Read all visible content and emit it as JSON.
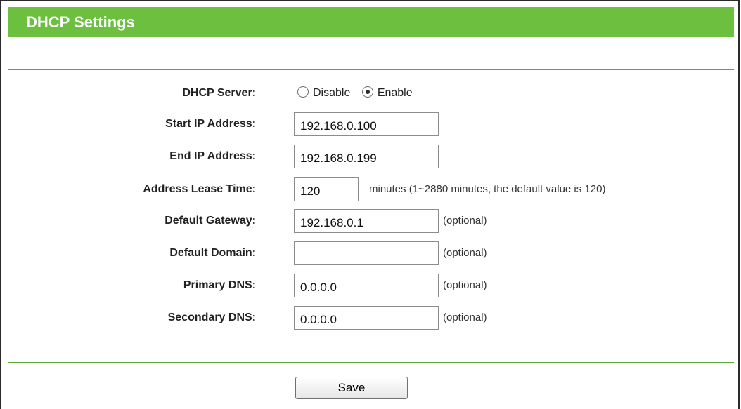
{
  "title": "DHCP Settings",
  "dhcp_server": {
    "label": "DHCP Server:",
    "options": [
      "Disable",
      "Enable"
    ],
    "selected": "Enable"
  },
  "fields": {
    "start_ip": {
      "label": "Start IP Address:",
      "value": "192.168.0.100"
    },
    "end_ip": {
      "label": "End IP Address:",
      "value": "192.168.0.199"
    },
    "lease_time": {
      "label": "Address Lease Time:",
      "value": "120",
      "hint": "minutes (1~2880 minutes, the default value is 120)"
    },
    "gateway": {
      "label": "Default Gateway:",
      "value": "192.168.0.1",
      "hint": "(optional)"
    },
    "domain": {
      "label": "Default Domain:",
      "value": "",
      "hint": "(optional)"
    },
    "primary_dns": {
      "label": "Primary DNS:",
      "value": "0.0.0.0",
      "hint": "(optional)"
    },
    "secondary_dns": {
      "label": "Secondary DNS:",
      "value": "0.0.0.0",
      "hint": "(optional)"
    }
  },
  "save_label": "Save",
  "colors": {
    "title_bar": "#6cbf3f",
    "divider": "#5aa83a"
  }
}
